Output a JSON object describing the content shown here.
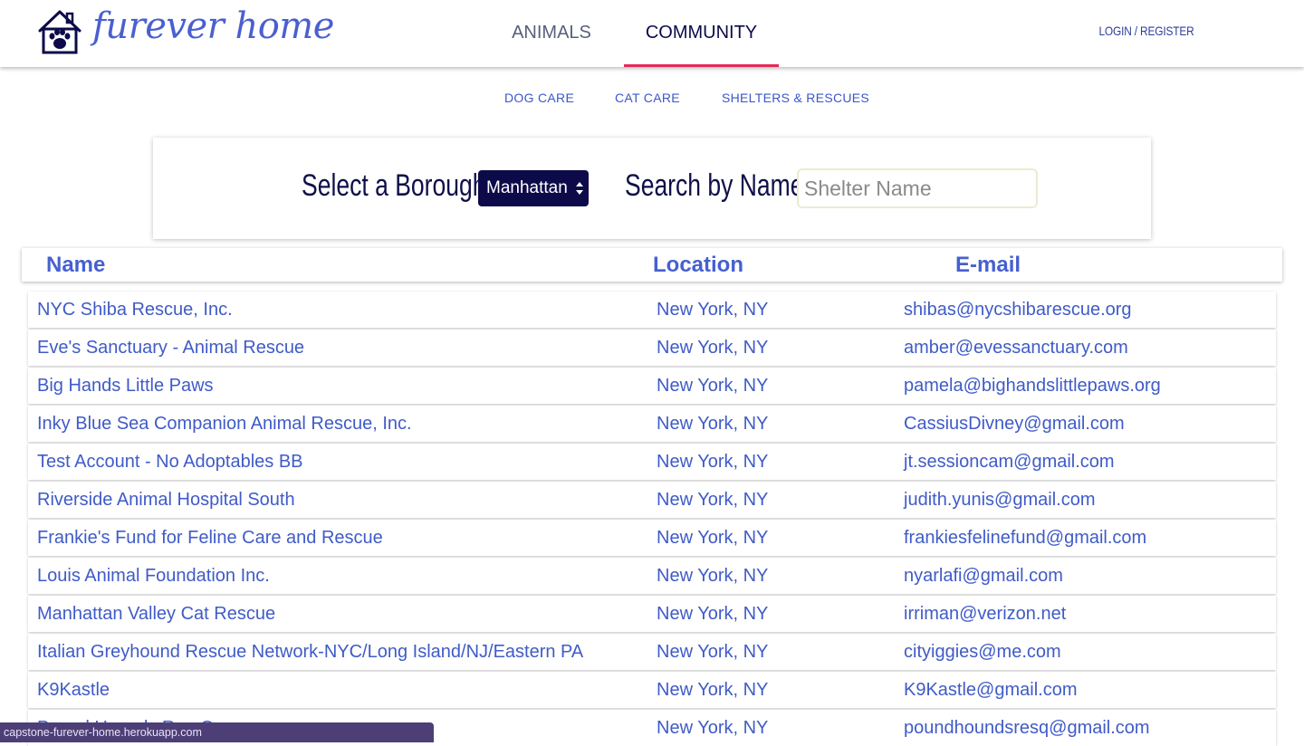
{
  "header": {
    "brand": "furever home",
    "nav": [
      {
        "label": "ANIMALS"
      },
      {
        "label": "COMMUNITY"
      }
    ],
    "login": "LOGIN / REGISTER"
  },
  "subnav": [
    {
      "label": "DOG CARE"
    },
    {
      "label": "CAT CARE"
    },
    {
      "label": "SHELTERS & RESCUES"
    }
  ],
  "filters": {
    "borough_label": "Select a Borough",
    "borough_value": "Manhattan",
    "search_label": "Search by Name",
    "search_placeholder": "Shelter Name"
  },
  "table": {
    "headers": {
      "name": "Name",
      "location": "Location",
      "email": "E-mail"
    },
    "rows": [
      {
        "name": "NYC Shiba Rescue, Inc.",
        "location": "New York, NY",
        "email": "shibas@nycshibarescue.org"
      },
      {
        "name": "Eve's Sanctuary - Animal Rescue",
        "location": "New York, NY",
        "email": "amber@evessanctuary.com"
      },
      {
        "name": "Big Hands Little Paws",
        "location": "New York, NY",
        "email": "pamela@bighandslittlepaws.org"
      },
      {
        "name": "Inky Blue Sea Companion Animal Rescue, Inc.",
        "location": "New York, NY",
        "email": "CassiusDivney@gmail.com"
      },
      {
        "name": "Test Account - No Adoptables BB",
        "location": "New York, NY",
        "email": "jt.sessioncam@gmail.com"
      },
      {
        "name": "Riverside Animal Hospital South",
        "location": "New York, NY",
        "email": "judith.yunis@gmail.com"
      },
      {
        "name": "Frankie's Fund for Feline Care and Rescue",
        "location": "New York, NY",
        "email": "frankiesfelinefund@gmail.com"
      },
      {
        "name": "Louis Animal Foundation Inc.",
        "location": "New York, NY",
        "email": "nyarlafi@gmail.com"
      },
      {
        "name": "Manhattan Valley Cat Rescue",
        "location": "New York, NY",
        "email": "irriman@verizon.net"
      },
      {
        "name": "Italian Greyhound Rescue Network-NYC/Long Island/NJ/Eastern PA",
        "location": "New York, NY",
        "email": "cityiggies@me.com"
      },
      {
        "name": "K9Kastle",
        "location": "New York, NY",
        "email": "K9Kastle@gmail.com"
      },
      {
        "name": "Pound Hounds Res-Q",
        "location": "New York, NY",
        "email": "poundhoundsresq@gmail.com"
      }
    ]
  },
  "statusbar": "capstone-furever-home.herokuapp.com",
  "colors": {
    "accent": "#e52a58",
    "navy": "#0d0a4a",
    "link": "#3f5bc8"
  }
}
